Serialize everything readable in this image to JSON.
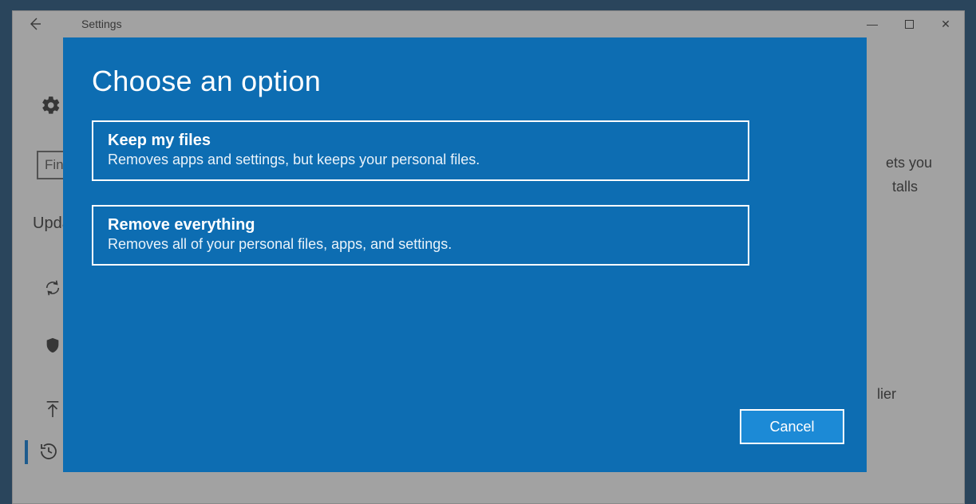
{
  "window": {
    "title": "Settings",
    "back_icon": "back-arrow",
    "minimize": "—",
    "maximize": "☐",
    "close": "✕"
  },
  "background": {
    "gear_icon": "gear",
    "search_placeholder": "Find a setting",
    "heading_fragment": "Update & security",
    "right_text_1": "ets you",
    "right_text_2": "talls",
    "right_text_3": "lier",
    "sidebar_items": [
      {
        "name": "windows-update",
        "icon": "sync"
      },
      {
        "name": "windows-defender",
        "icon": "shield"
      },
      {
        "name": "backup",
        "icon": "arrow-up"
      },
      {
        "name": "recovery",
        "icon": "history"
      },
      {
        "name": "activation",
        "icon": "activation"
      }
    ]
  },
  "dialog": {
    "title": "Choose an option",
    "options": [
      {
        "title": "Keep my files",
        "description": "Removes apps and settings, but keeps your personal files."
      },
      {
        "title": "Remove everything",
        "description": "Removes all of your personal files, apps, and settings."
      }
    ],
    "cancel_label": "Cancel"
  }
}
